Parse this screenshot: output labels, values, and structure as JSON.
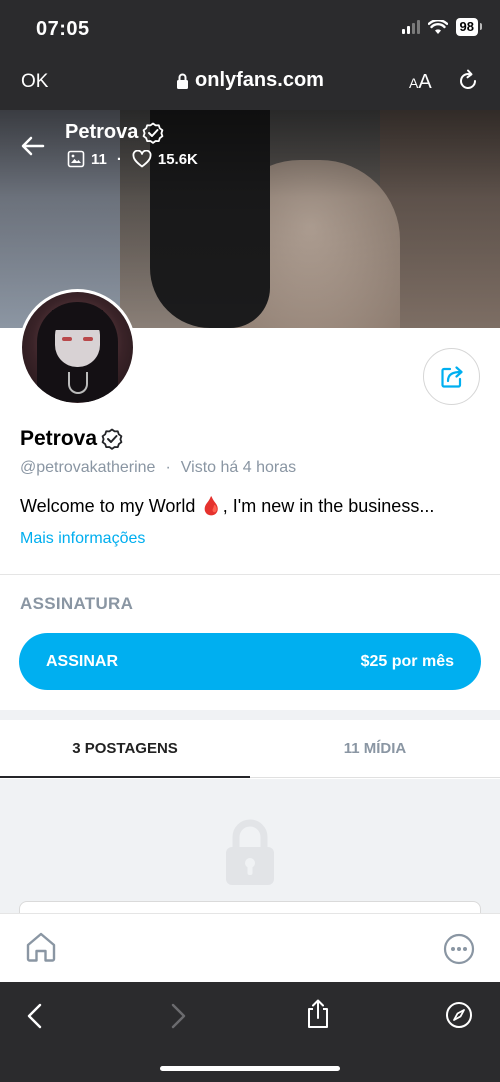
{
  "status_bar": {
    "time": "07:05",
    "battery": "98"
  },
  "browser": {
    "ok_label": "OK",
    "url": "onlyfans.com",
    "text_size_label_small": "A",
    "text_size_label_large": "A"
  },
  "cover": {
    "name": "Petrova",
    "photos_count": "11",
    "likes_count": "15.6K"
  },
  "profile": {
    "name": "Petrova",
    "username": "@petrovakatherine",
    "separator": "·",
    "last_seen": "Visto  há 4 horas",
    "bio": "Welcome to my World 🩸, I'm new in the business...",
    "bio_icon": "🩸",
    "more_info": "Mais informações"
  },
  "subscription": {
    "title": "ASSINATURA",
    "button_label": "ASSINAR",
    "price": "$25 por mês"
  },
  "tabs": [
    {
      "label": "3 POSTAGENS",
      "active": true
    },
    {
      "label": "11 MÍDIA",
      "active": false
    }
  ],
  "colors": {
    "accent": "#00aff0",
    "link": "#00aeef",
    "muted": "#8a96a3",
    "chrome": "#2b2b2d"
  }
}
